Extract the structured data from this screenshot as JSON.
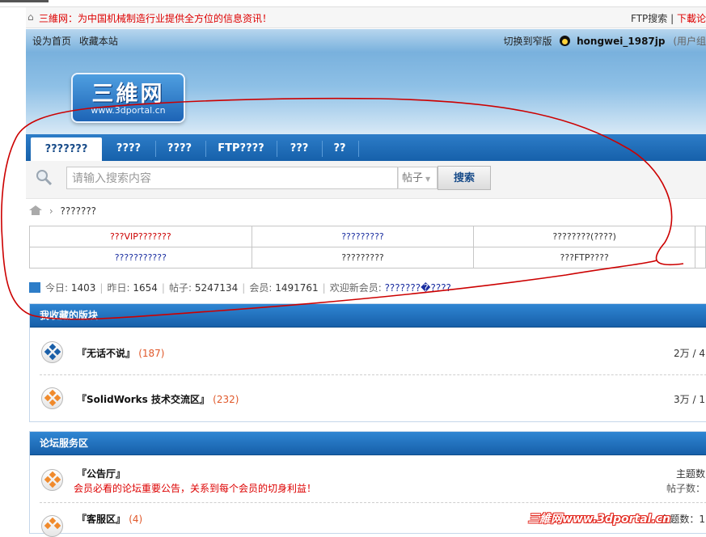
{
  "topbar": {
    "slogan": "三維网：为中国机械制造行业提供全方位的信息资讯！",
    "ftp_link": "FTP搜索",
    "download_link": "下載论"
  },
  "header": {
    "set_home": "设为首页",
    "bookmark": "收藏本站",
    "switch_width": "切换到窄版",
    "username": "hongwei_1987jp",
    "user_group": "(用户组"
  },
  "logo": {
    "text": "三維网",
    "url": "www.3dportal.cn"
  },
  "nav": {
    "tabs": [
      {
        "label": "???????",
        "active": true
      },
      {
        "label": "????",
        "active": false
      },
      {
        "label": "????",
        "active": false
      },
      {
        "label": "FTP????",
        "active": false
      },
      {
        "label": "???",
        "active": false
      },
      {
        "label": "??",
        "active": false
      }
    ]
  },
  "search": {
    "placeholder": "请输入搜索内容",
    "type_label": "帖子",
    "button_label": "搜索"
  },
  "breadcrumb": {
    "current": "???????"
  },
  "link_table": {
    "rows": [
      [
        "???VIP???????",
        "?????????",
        "????????(????)"
      ],
      [
        "???????????",
        "?????????",
        "???FTP????"
      ]
    ]
  },
  "stats": {
    "today_label": "今日:",
    "today": "1403",
    "yesterday_label": "昨日:",
    "yesterday": "1654",
    "posts_label": "帖子:",
    "posts": "5247134",
    "members_label": "会员:",
    "members": "1491761",
    "welcome_label": "欢迎新会员:",
    "newest_member": "???????�????"
  },
  "favorites": {
    "title": "我收藏的版块",
    "forums": [
      {
        "name": "『无话不说』",
        "count": "(187)",
        "right": "2万 / 4"
      },
      {
        "name": "『SolidWorks 技术交流区』",
        "count": "(232)",
        "right": "3万 / 1"
      }
    ]
  },
  "service": {
    "title": "论坛服务区",
    "forums": [
      {
        "name": "『公告厅』",
        "count": "",
        "desc": "会员必看的论坛重要公告，关系到每个会员的切身利益！",
        "right1": "主题数",
        "right2": "帖子数："
      },
      {
        "name": "『客服区』",
        "count": "(4)",
        "desc": "",
        "right1": "主题数：1",
        "right2": ""
      }
    ]
  },
  "watermark": "三維网www.3dportal.cn",
  "colors": {
    "nav_blue": "#1a66b3",
    "slogan_red": "#dd0000",
    "annotation_red": "#cc0000",
    "link_blue": "#1a2ea0"
  }
}
